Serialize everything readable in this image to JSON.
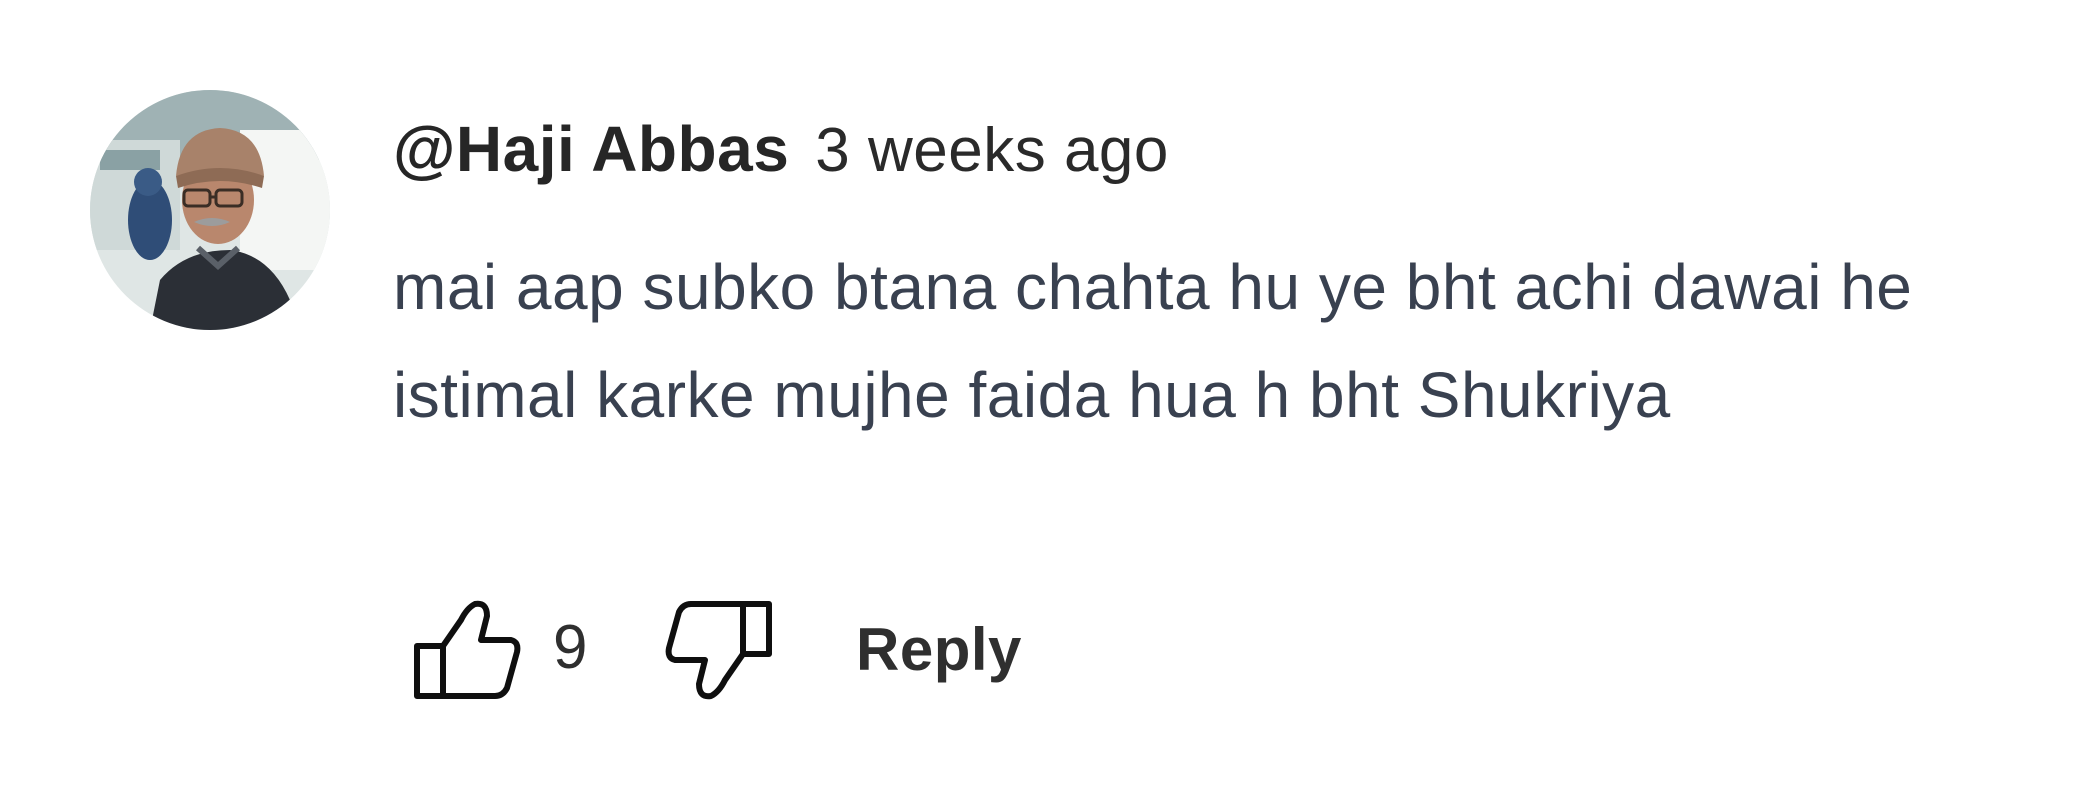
{
  "comment": {
    "author": "@Haji Abbas",
    "timestamp": "3 weeks ago",
    "text": "mai aap subko btana chahta hu ye bht achi dawai he istimal karke mujhe faida hua h bht Shukriya",
    "like_count": "9",
    "reply_label": "Reply",
    "avatar_icon": "user-avatar-photo",
    "like_icon": "thumbs-up-icon",
    "dislike_icon": "thumbs-down-icon"
  }
}
